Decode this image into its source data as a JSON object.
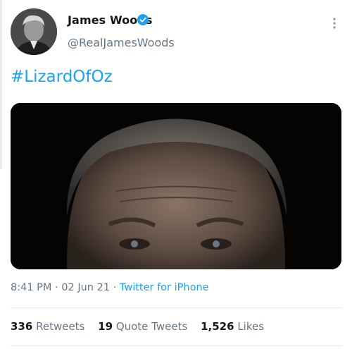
{
  "author": {
    "display_name": "James Woods",
    "handle": "@RealJamesWoods",
    "verified": true,
    "avatar_icon": "profile-photo",
    "verified_icon": "verified-badge-icon",
    "menu_icon": "more-vertical-icon"
  },
  "tweet": {
    "text": "#LizardOfOz",
    "media_description": "photo"
  },
  "meta": {
    "time": "8:41 PM",
    "separator": "·",
    "date": "02 Jun 21",
    "source": "Twitter for iPhone"
  },
  "stats": {
    "retweets_count": "336",
    "retweets_label": "Retweets",
    "quotes_count": "19",
    "quotes_label": "Quote Tweets",
    "likes_count": "1,526",
    "likes_label": "Likes"
  },
  "colors": {
    "accent": "#1da1f2",
    "secondary_text": "#657786",
    "primary_text": "#14171a",
    "divider": "#e6ecf0"
  }
}
